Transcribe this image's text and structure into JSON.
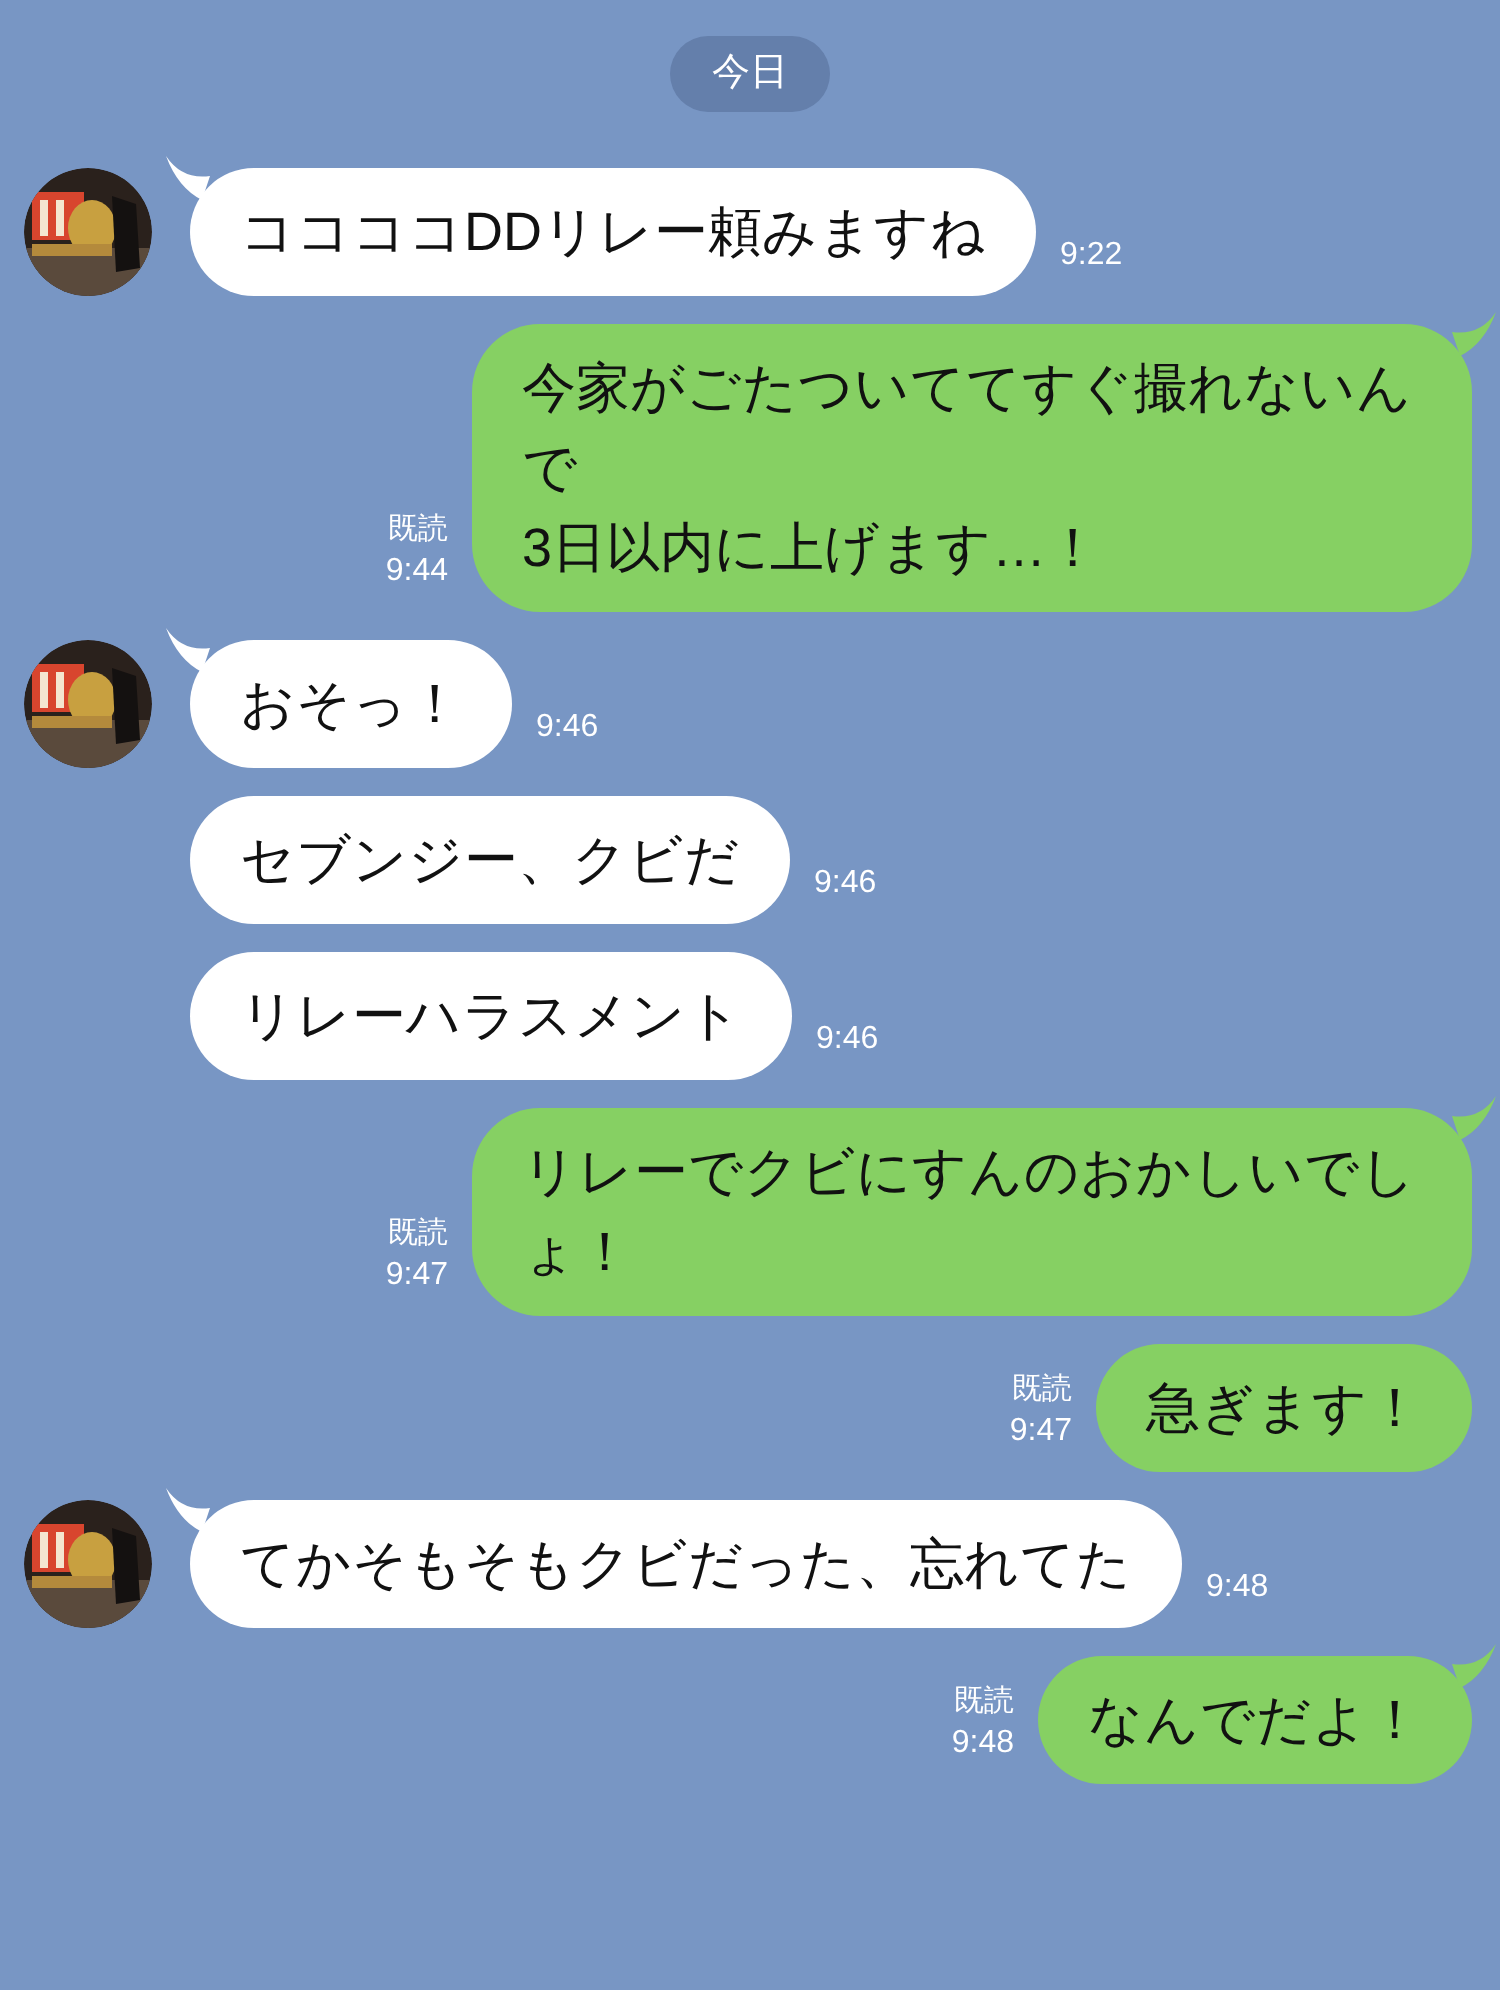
{
  "date_label": "今日",
  "messages": [
    {
      "kind": "incoming",
      "text": "ココココDDリレー頼みますね",
      "time": "9:22"
    },
    {
      "kind": "outgoing",
      "text": "今家がごたついててすぐ撮れないんで\n3日以内に上げます…！",
      "read": "既読",
      "time": "9:44"
    },
    {
      "kind": "incoming",
      "text": "おそっ！",
      "time": "9:46"
    },
    {
      "kind": "incoming",
      "text": "セブンジー、クビだ",
      "time": "9:46"
    },
    {
      "kind": "incoming",
      "text": "リレーハラスメント",
      "time": "9:46"
    },
    {
      "kind": "outgoing",
      "text": "リレーでクビにすんのおかしいでしょ！",
      "read": "既読",
      "time": "9:47"
    },
    {
      "kind": "outgoing",
      "text": "急ぎます！",
      "read": "既読",
      "time": "9:47",
      "tail": false
    },
    {
      "kind": "incoming",
      "text": "てかそもそもクビだった、忘れてた",
      "time": "9:48"
    },
    {
      "kind": "outgoing",
      "text": "なんでだよ！",
      "read": "既読",
      "time": "9:48"
    }
  ]
}
